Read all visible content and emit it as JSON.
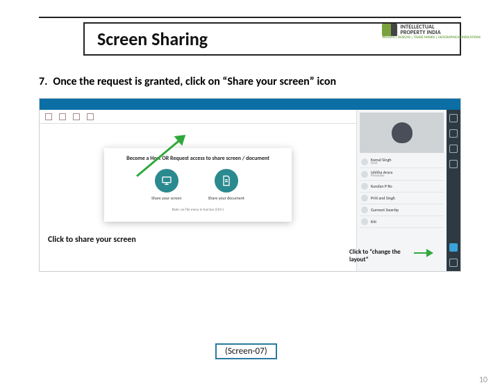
{
  "logo": {
    "line1": "INTELLECTUAL",
    "line2": "PROPERTY INDIA",
    "sub": "PATENTS | DESIGNS | TRADE MARKS | GEOGRAPHICAL INDICATIONS"
  },
  "title": "Screen Sharing",
  "step": {
    "num": "7.",
    "text": "Once the request is granted, click on “Share your screen” icon"
  },
  "modal": {
    "title": "Become a Host OR Request access to share screen / document",
    "opt1": "Share your screen",
    "opt2": "Share your document",
    "note": "Note: on File menu in tool bar (Ctrl+)"
  },
  "participants": [
    {
      "name": "Kamal Singh",
      "role": "Host"
    },
    {
      "name": "Ishitha Arora",
      "role": "Presenter"
    },
    {
      "name": "Kundan P Ro",
      "role": ""
    },
    {
      "name": "Priti and Singh",
      "role": ""
    },
    {
      "name": "Gurneet Swartip",
      "role": ""
    },
    {
      "name": "Kiti",
      "role": ""
    }
  ],
  "callouts": {
    "share": "Click to share your screen",
    "layout": "Click to “change the layout”"
  },
  "caption": "(Screen-07)",
  "pagenum": "10"
}
